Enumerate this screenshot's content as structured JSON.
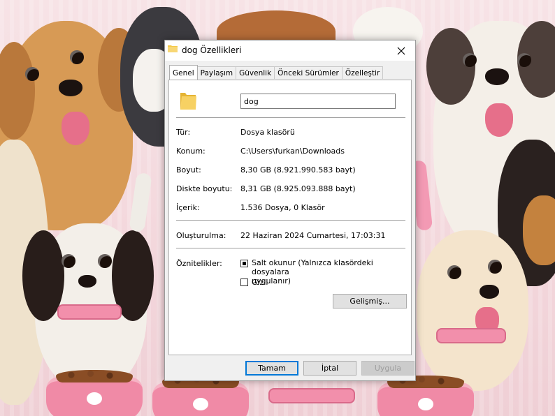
{
  "window": {
    "title": "dog Özellikleri"
  },
  "tabs": [
    {
      "label": "Genel"
    },
    {
      "label": "Paylaşım"
    },
    {
      "label": "Güvenlik"
    },
    {
      "label": "Önceki Sürümler"
    },
    {
      "label": "Özelleştir"
    }
  ],
  "general": {
    "folder_name": "dog",
    "type_label": "Tür:",
    "type_value": "Dosya klasörü",
    "location_label": "Konum:",
    "location_value": "C:\\Users\\furkan\\Downloads",
    "size_label": "Boyut:",
    "size_value": "8,30 GB (8.921.990.583 bayt)",
    "disk_size_label": "Diskte boyutu:",
    "disk_size_value": "8,31 GB (8.925.093.888 bayt)",
    "contains_label": "İçerik:",
    "contains_value": "1.536 Dosya, 0 Klasör",
    "created_label": "Oluşturulma:",
    "created_value": "22 Haziran 2024 Cumartesi, 17:03:31",
    "attributes_label": "Öznitelikler:",
    "readonly_line1": "Salt okunur (Yalnızca klasördeki dosyalara",
    "readonly_line2": "uygulanır)",
    "hidden_label": "Gizli",
    "advanced_button": "Gelişmiş..."
  },
  "footer": {
    "ok_button": "Tamam",
    "cancel_button": "İptal",
    "apply_button": "Uygula"
  },
  "colors": {
    "accent": "#0078d7",
    "folder_yellow": "#f4c949"
  }
}
